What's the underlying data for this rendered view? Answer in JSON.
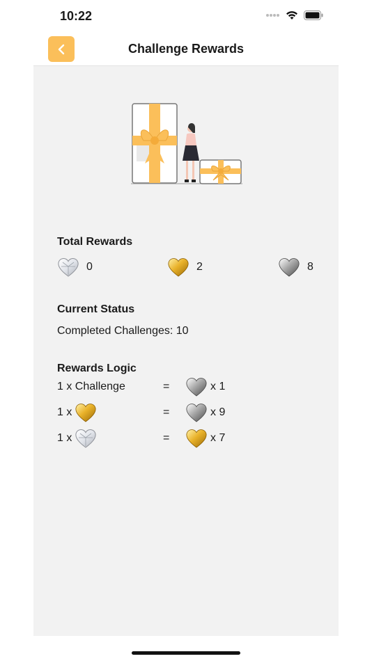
{
  "status_bar": {
    "time": "10:22"
  },
  "nav": {
    "title": "Challenge Rewards",
    "back_icon": "chevron-left-icon"
  },
  "colors": {
    "accent": "#fbbf5a",
    "background": "#f2f2f2",
    "gold": "#e2a823",
    "silver": "#9a9a9a"
  },
  "total_rewards": {
    "title": "Total Rewards",
    "items": [
      {
        "icon": "diamond-heart-icon",
        "count": "0"
      },
      {
        "icon": "gold-heart-icon",
        "count": "2"
      },
      {
        "icon": "silver-heart-icon",
        "count": "8"
      }
    ]
  },
  "current_status": {
    "title": "Current Status",
    "completed_text": "Completed Challenges: 10"
  },
  "rewards_logic": {
    "title": "Rewards Logic",
    "rows": [
      {
        "lhs_text": "1 x Challenge",
        "lhs_icon": "",
        "equals": "=",
        "rhs_icon": "silver-heart-icon",
        "rhs_text": "x 1"
      },
      {
        "lhs_text": "1 x",
        "lhs_icon": "gold-heart-icon",
        "equals": "=",
        "rhs_icon": "silver-heart-icon",
        "rhs_text": "x 9"
      },
      {
        "lhs_text": "1 x",
        "lhs_icon": "diamond-heart-icon",
        "equals": "=",
        "rhs_icon": "gold-heart-icon",
        "rhs_text": "x 7"
      }
    ]
  }
}
